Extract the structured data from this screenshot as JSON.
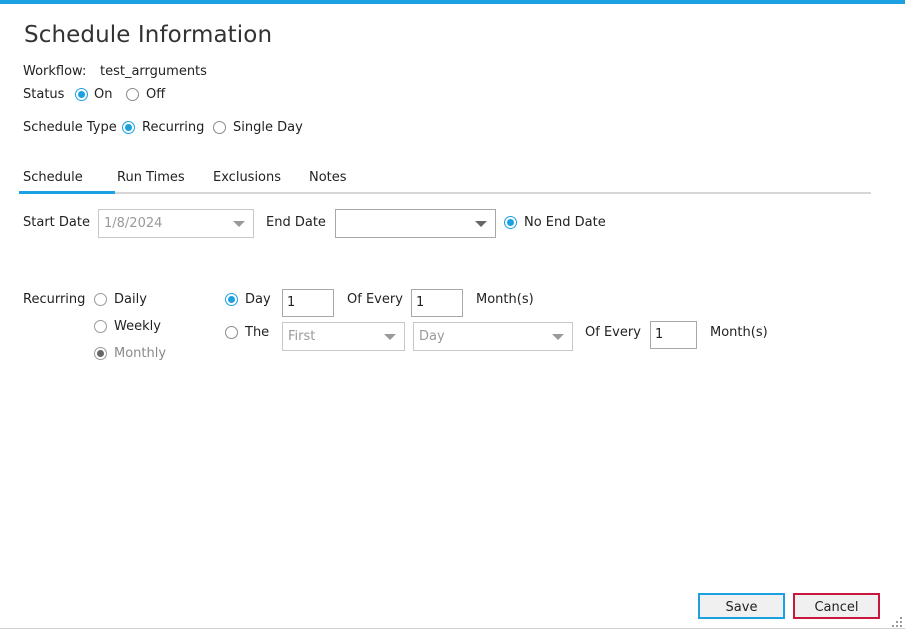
{
  "header": {
    "title": "Schedule Information"
  },
  "workflow": {
    "label": "Workflow:",
    "value": "test_arrguments"
  },
  "status": {
    "label": "Status",
    "on_label": "On",
    "off_label": "Off",
    "selected": "On"
  },
  "schedule_type": {
    "label": "Schedule Type",
    "recurring_label": "Recurring",
    "single_day_label": "Single Day",
    "selected": "Recurring"
  },
  "tabs": [
    {
      "label": "Schedule",
      "active": true
    },
    {
      "label": "Run Times",
      "active": false
    },
    {
      "label": "Exclusions",
      "active": false
    },
    {
      "label": "Notes",
      "active": false
    }
  ],
  "dates": {
    "start_label": "Start Date",
    "start_value": "1/8/2024",
    "end_label": "End Date",
    "end_value": "",
    "no_end_label": "No End Date",
    "no_end_checked": true
  },
  "recurring": {
    "label": "Recurring",
    "options": [
      "Daily",
      "Weekly",
      "Monthly"
    ],
    "selected": "Monthly",
    "day_option": {
      "label": "Day",
      "day_value": "1",
      "of_every_label": "Of Every",
      "months_value": "1",
      "months_label": "Month(s)"
    },
    "the_option": {
      "label": "The",
      "ordinal_value": "First",
      "weekday_value": "Day",
      "of_every_label": "Of Every",
      "months_value": "1",
      "months_label": "Month(s)"
    },
    "monthly_mode": "Day"
  },
  "buttons": {
    "save_label": "Save",
    "cancel_label": "Cancel"
  },
  "colors": {
    "accent": "#1ba1e2",
    "cancel_border": "#c8183f",
    "text": "#222222",
    "disabled": "#9a9a9a"
  }
}
